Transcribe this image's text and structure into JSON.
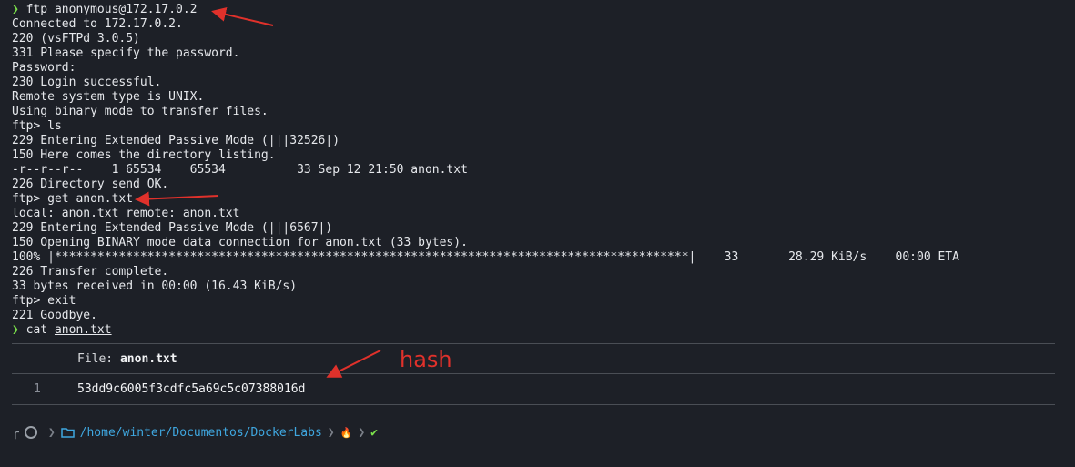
{
  "terminal": {
    "lines": [
      {
        "prompt": "❯",
        "cmd": "ftp anonymous@172.17.0.2"
      },
      {
        "text": "Connected to 172.17.0.2."
      },
      {
        "text": "220 (vsFTPd 3.0.5)"
      },
      {
        "text": "331 Please specify the password."
      },
      {
        "text": "Password:"
      },
      {
        "text": "230 Login successful."
      },
      {
        "text": "Remote system type is UNIX."
      },
      {
        "text": "Using binary mode to transfer files."
      },
      {
        "text": "ftp> ls"
      },
      {
        "text": "229 Entering Extended Passive Mode (|||32526|)"
      },
      {
        "text": "150 Here comes the directory listing."
      },
      {
        "text": "-r--r--r--    1 65534    65534          33 Sep 12 21:50 anon.txt"
      },
      {
        "text": "226 Directory send OK."
      },
      {
        "text": "ftp> get anon.txt"
      },
      {
        "text": "local: anon.txt remote: anon.txt"
      },
      {
        "text": "229 Entering Extended Passive Mode (|||6567|)"
      },
      {
        "text": "150 Opening BINARY mode data connection for anon.txt (33 bytes)."
      },
      {
        "text": "100% |*****************************************************************************************|    33       28.29 KiB/s    00:00 ETA"
      },
      {
        "text": "226 Transfer complete."
      },
      {
        "text": "33 bytes received in 00:00 (16.43 KiB/s)"
      },
      {
        "text": "ftp> exit"
      },
      {
        "text": "221 Goodbye."
      },
      {
        "prompt": "❯",
        "cmd": "cat ",
        "arg": "anon.txt"
      }
    ]
  },
  "bat": {
    "file_label": "File:",
    "file_name": "anon.txt",
    "line_number": "1",
    "content": "53dd9c6005f3cdfc5a69c5c07388016d"
  },
  "annotation": {
    "hash_label": "hash",
    "color": "#e0312b"
  },
  "prompt_bar": {
    "os_icon": "@",
    "folder_icon": "folder-icon",
    "path_parts": [
      "/home/",
      "winter/",
      "Documentos/",
      "DockerLabs"
    ],
    "flame": "🔥",
    "check": "✔"
  }
}
